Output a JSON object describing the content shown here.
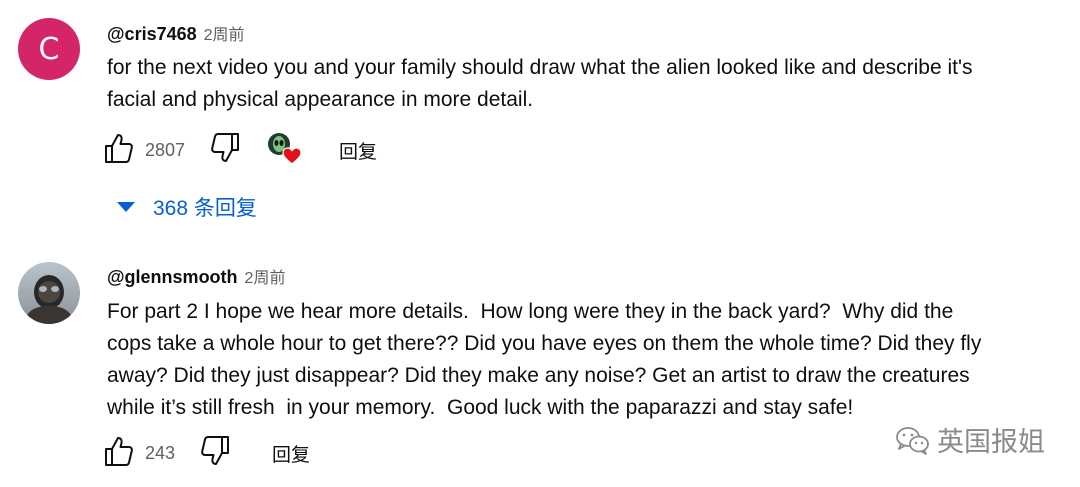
{
  "comments": [
    {
      "avatar_letter": "C",
      "avatar_color": "#d52569",
      "username": "@cris7468",
      "time": "2周前",
      "text_lines": [
        "for the next video you and your family should draw what the alien looked like and describe it's",
        "facial and physical appearance in more detail."
      ],
      "like_count": "2807",
      "reply_label": "回复",
      "creator_heart": "alien-avatar-with-red-heart",
      "replies_toggle": "368 条回复"
    },
    {
      "avatar_description": "photo-avatar",
      "username": "@glennsmooth",
      "time": "2周前",
      "text_lines": [
        "For part 2 I hope we hear more details.  How long were they in the back yard?  Why did the",
        "cops take a whole hour to get there?? Did you have eyes on them the whole time? Did they fly",
        "away? Did they just disappear? Did they make any noise? Get an artist to draw the creatures",
        "while it’s still fresh  in your memory.  Good luck with the paparazzi and stay safe!"
      ],
      "like_count": "243",
      "reply_label": "回复"
    }
  ],
  "watermark": {
    "text": "英国报姐",
    "icon": "wechat-icon"
  },
  "colors": {
    "link": "#065fd4",
    "secondary_text": "#606060",
    "heart": "#e0111b"
  }
}
